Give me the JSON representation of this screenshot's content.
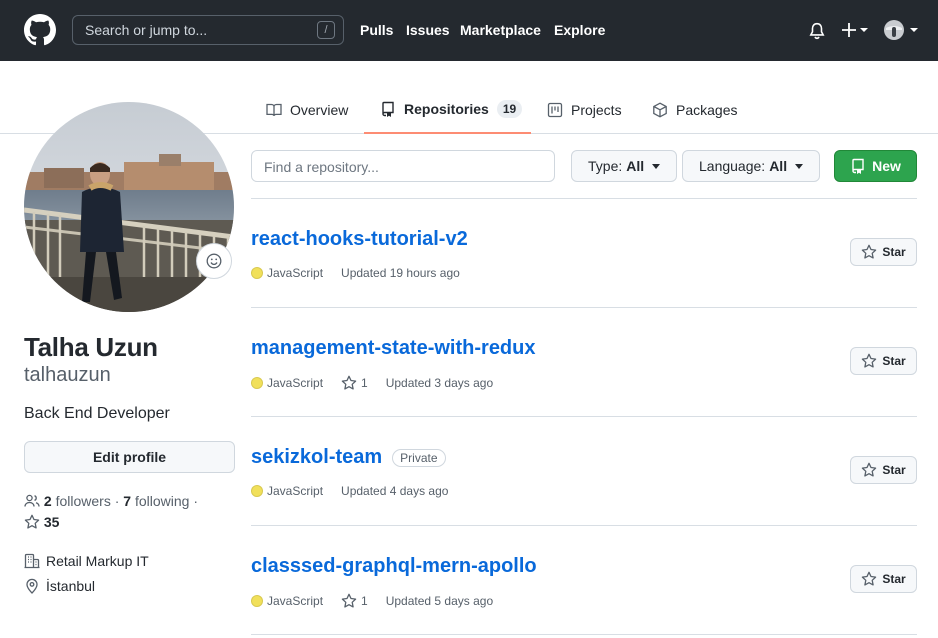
{
  "header": {
    "search_placeholder": "Search or jump to...",
    "search_shortcut": "/",
    "nav": [
      "Pulls",
      "Issues",
      "Marketplace",
      "Explore"
    ]
  },
  "tabs": [
    {
      "label": "Overview",
      "icon": "book-icon"
    },
    {
      "label": "Repositories",
      "icon": "repo-icon",
      "count": "19",
      "active": true
    },
    {
      "label": "Projects",
      "icon": "project-icon"
    },
    {
      "label": "Packages",
      "icon": "package-icon"
    }
  ],
  "profile": {
    "fullname": "Talha Uzun",
    "username": "talhauzun",
    "bio": "Back End Developer",
    "edit_label": "Edit profile",
    "followers_count": "2",
    "followers_label": "followers",
    "separator": "·",
    "following_count": "7",
    "following_label": "following",
    "stars_count": "35",
    "company": "Retail Markup IT",
    "location": "İstanbul"
  },
  "controls": {
    "find_placeholder": "Find a repository...",
    "type_label": "Type:",
    "type_value": "All",
    "language_label": "Language:",
    "language_value": "All",
    "new_label": "New"
  },
  "repos": [
    {
      "name": "react-hooks-tutorial-v2",
      "language": "JavaScript",
      "stars": "",
      "updated": "Updated 19 hours ago",
      "private": ""
    },
    {
      "name": "management-state-with-redux",
      "language": "JavaScript",
      "stars": "1",
      "updated": "Updated 3 days ago",
      "private": ""
    },
    {
      "name": "sekizkol-team",
      "language": "JavaScript",
      "stars": "",
      "updated": "Updated 4 days ago",
      "private": "Private"
    },
    {
      "name": "classsed-graphql-mern-apollo",
      "language": "JavaScript",
      "stars": "1",
      "updated": "Updated 5 days ago",
      "private": ""
    }
  ],
  "star_label": "Star",
  "colors": {
    "header_bg": "#24292f",
    "link": "#0969da",
    "primary_button": "#2da44e",
    "active_tab_underline": "#fd8c73",
    "javascript": "#f1e05a"
  }
}
